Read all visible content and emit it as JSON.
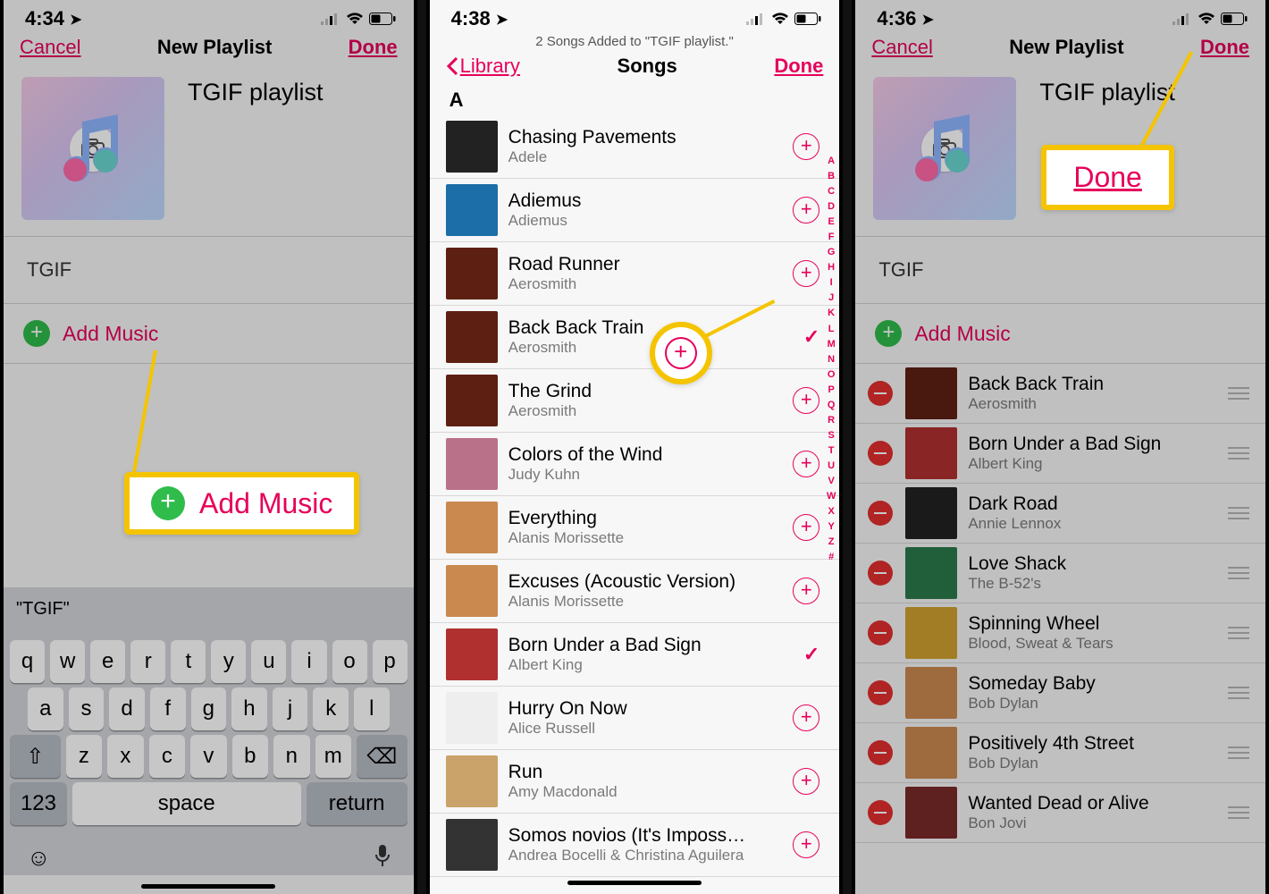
{
  "colors": {
    "accent": "#e6005a",
    "highlight": "#f5c400",
    "add_green": "#2fbc4b",
    "remove_red": "#e22f2f"
  },
  "screen1": {
    "time": "4:34",
    "nav": {
      "left": "Cancel",
      "title": "New Playlist",
      "right": "Done"
    },
    "playlist_name": "TGIF playlist",
    "description_placeholder": "TGIF",
    "add_music_label": "Add Music",
    "keyboard_suggestion": "\"TGIF\"",
    "keyboard_rows": [
      [
        "q",
        "w",
        "e",
        "r",
        "t",
        "y",
        "u",
        "i",
        "o",
        "p"
      ],
      [
        "a",
        "s",
        "d",
        "f",
        "g",
        "h",
        "j",
        "k",
        "l"
      ],
      [
        "⇧",
        "z",
        "x",
        "c",
        "v",
        "b",
        "n",
        "m",
        "⌫"
      ]
    ],
    "keyboard_bottom": {
      "numbers": "123",
      "space": "space",
      "return": "return"
    },
    "emoji_icon": "😊",
    "mic_icon": "🎤",
    "callout_label": "Add Music"
  },
  "screen2": {
    "time": "4:38",
    "toast": "2 Songs Added to \"TGIF playlist.\"",
    "nav": {
      "back": "Library",
      "title": "Songs",
      "right": "Done"
    },
    "section": "A",
    "songs": [
      {
        "title": "Chasing Pavements",
        "artist": "Adele",
        "state": "add"
      },
      {
        "title": "Adiemus",
        "artist": "Adiemus",
        "state": "add"
      },
      {
        "title": "Road Runner",
        "artist": "Aerosmith",
        "state": "add"
      },
      {
        "title": "Back Back Train",
        "artist": "Aerosmith",
        "state": "added"
      },
      {
        "title": "The Grind",
        "artist": "Aerosmith",
        "state": "add"
      },
      {
        "title": "Colors of the Wind",
        "artist": "Judy Kuhn",
        "state": "add"
      },
      {
        "title": "Everything",
        "artist": "Alanis Morissette",
        "state": "add"
      },
      {
        "title": "Excuses (Acoustic Version)",
        "artist": "Alanis Morissette",
        "state": "add"
      },
      {
        "title": "Born Under a Bad Sign",
        "artist": "Albert King",
        "state": "added"
      },
      {
        "title": "Hurry On Now",
        "artist": "Alice Russell",
        "state": "add"
      },
      {
        "title": "Run",
        "artist": "Amy Macdonald",
        "state": "add"
      },
      {
        "title": "Somos novios (It's Imposs…",
        "artist": "Andrea Bocelli & Christina Aguilera",
        "state": "add"
      }
    ],
    "index_letters": [
      "A",
      "B",
      "C",
      "D",
      "E",
      "F",
      "G",
      "H",
      "I",
      "J",
      "K",
      "L",
      "M",
      "N",
      "O",
      "P",
      "Q",
      "R",
      "S",
      "T",
      "U",
      "V",
      "W",
      "X",
      "Y",
      "Z",
      "#"
    ]
  },
  "screen3": {
    "time": "4:36",
    "nav": {
      "left": "Cancel",
      "title": "New Playlist",
      "right": "Done"
    },
    "playlist_name": "TGIF playlist",
    "description_placeholder": "TGIF",
    "add_music_label": "Add Music",
    "callout_label": "Done",
    "songs": [
      {
        "title": "Back Back Train",
        "artist": "Aerosmith"
      },
      {
        "title": "Born Under a Bad Sign",
        "artist": "Albert King"
      },
      {
        "title": "Dark Road",
        "artist": "Annie Lennox"
      },
      {
        "title": "Love Shack",
        "artist": "The B-52's"
      },
      {
        "title": "Spinning Wheel",
        "artist": "Blood, Sweat & Tears"
      },
      {
        "title": "Someday Baby",
        "artist": "Bob Dylan"
      },
      {
        "title": "Positively 4th Street",
        "artist": "Bob Dylan"
      },
      {
        "title": "Wanted Dead or Alive",
        "artist": "Bon Jovi"
      }
    ]
  }
}
